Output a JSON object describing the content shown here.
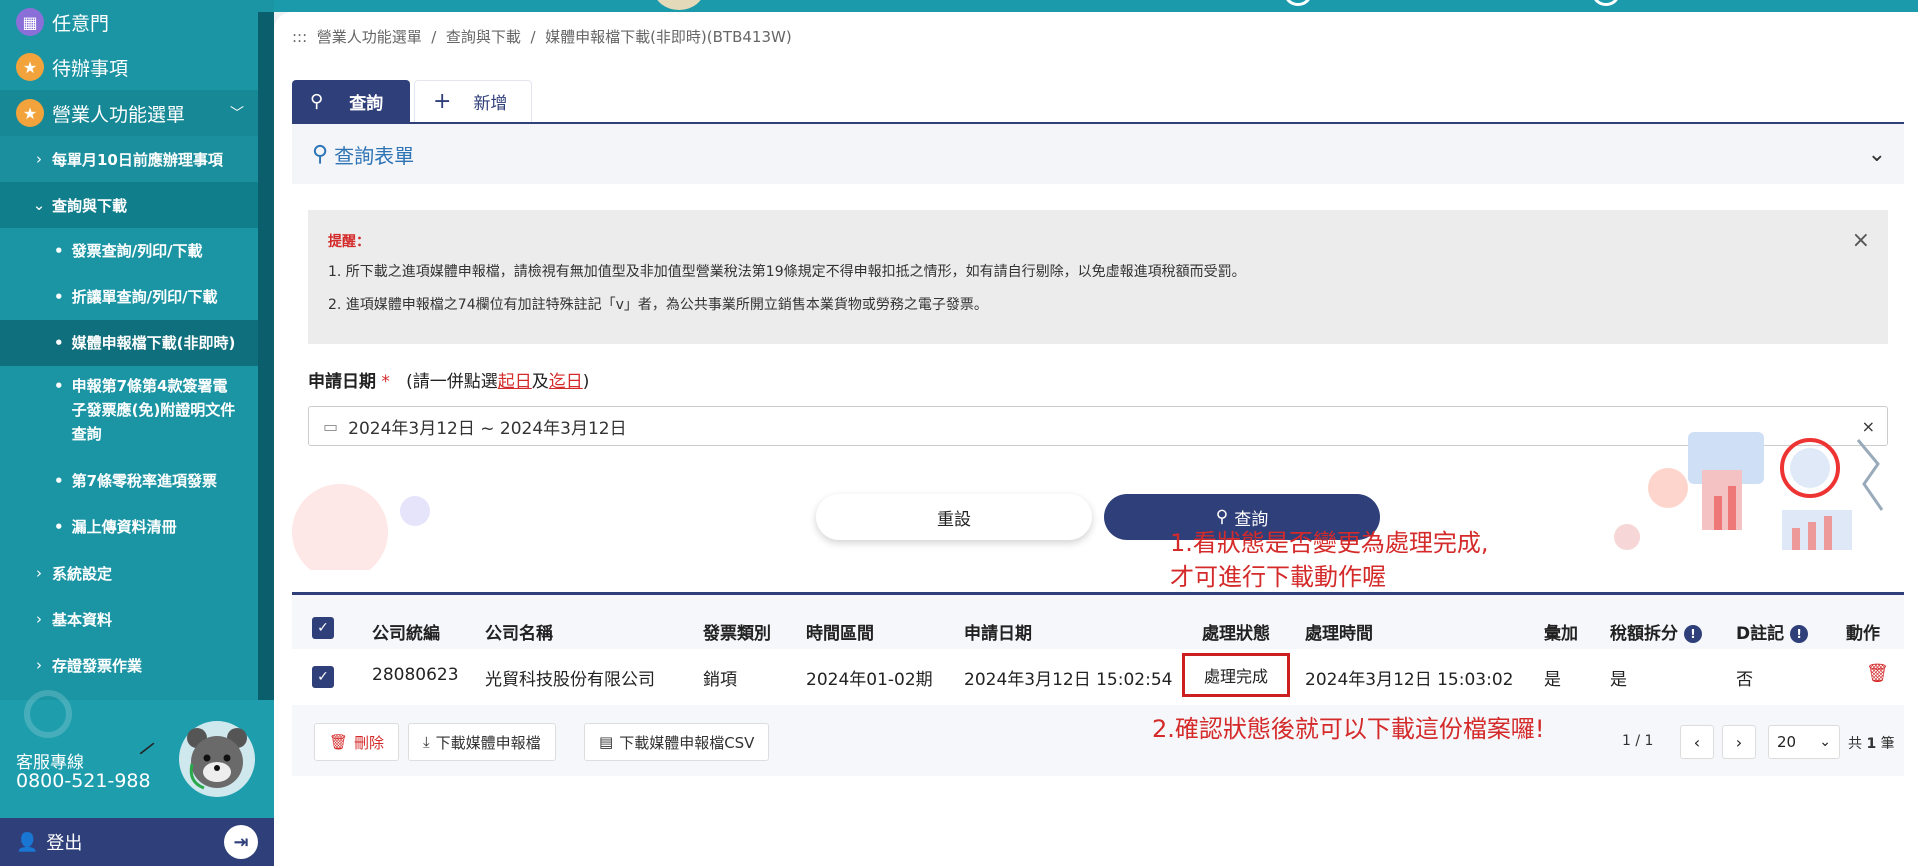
{
  "sidebar": {
    "items": [
      {
        "label": "任意門"
      },
      {
        "label": "待辦事項"
      },
      {
        "label": "營業人功能選單"
      }
    ],
    "subitems": [
      {
        "label": "每單月10日前應辦理事項"
      },
      {
        "label": "查詢與下載"
      },
      {
        "label": "系統設定"
      },
      {
        "label": "基本資料"
      },
      {
        "label": "存證發票作業"
      }
    ],
    "leaves": [
      {
        "label": "發票查詢/列印/下載"
      },
      {
        "label": "折讓單查詢/列印/下載"
      },
      {
        "label": "媒體申報檔下載(非即時)"
      },
      {
        "label": "申報第7條第4款簽署電子發票應(免)附證明文件查詢"
      },
      {
        "label": "第7條零稅率進項發票"
      },
      {
        "label": "漏上傳資料清冊"
      }
    ],
    "customer_service_label": "客服專線",
    "customer_service_phone": "0800-521-988",
    "logout": "登出"
  },
  "breadcrumb": {
    "prefix": ":::",
    "items": [
      "營業人功能選單",
      "查詢與下載",
      "媒體申報檔下載(非即時)(BTB413W)"
    ],
    "sep": "/"
  },
  "tabs": [
    {
      "label": "查詢"
    },
    {
      "label": "新增"
    }
  ],
  "form": {
    "title": "查詢表單",
    "notice_title": "提醒：",
    "notice_lines": [
      "1. 所下載之進項媒體申報檔，請檢視有無加值型及非加值型營業稅法第19條規定不得申報扣抵之情形，如有請自行剔除，以免虛報進項稅額而受罰。",
      "2. 進項媒體申報檔之74欄位有加註特殊註記「v」者，為公共事業所開立銷售本業貨物或勞務之電子發票。"
    ],
    "date_label": "申請日期",
    "required_mark": "*",
    "date_hint_open": "(請一併點選",
    "date_hint_start": "起日",
    "date_hint_and": "及",
    "date_hint_end": "迄日",
    "date_hint_close": ")",
    "date_value": "2024年3月12日 ~ 2024年3月12日",
    "reset_button": "重設",
    "query_button": "查詢"
  },
  "table": {
    "headers": [
      "公司統編",
      "公司名稱",
      "發票類別",
      "時間區間",
      "申請日期",
      "處理狀態",
      "處理時間",
      "彙加",
      "稅額拆分",
      "D註記",
      "動作"
    ],
    "rows": [
      {
        "tax_id": "28080623",
        "company": "光貿科技股份有限公司",
        "type": "銷項",
        "period": "2024年01-02期",
        "apply_date": "2024年3月12日 15:02:54",
        "status": "處理完成",
        "process_time": "2024年3月12日 15:03:02",
        "aggregate": "是",
        "tax_split": "是",
        "d_note": "否"
      }
    ]
  },
  "actions": {
    "delete": "刪除",
    "download": "下載媒體申報檔",
    "download_csv": "下載媒體申報檔CSV"
  },
  "pagination": {
    "page": "1 / 1",
    "page_size": "20",
    "total_prefix": "共",
    "total_count": "1",
    "total_suffix": "筆"
  },
  "annotations": {
    "note1_line1": "1.看狀態是否變更為處理完成,",
    "note1_line2": "才可進行下載動作喔",
    "note2": "2.確認狀態後就可以下載這份檔案囉!"
  },
  "colors": {
    "sidebar": "#1b95a4",
    "navy": "#2f3f7a",
    "accent_red": "#d42a2a",
    "link_blue": "#2e74b5"
  }
}
